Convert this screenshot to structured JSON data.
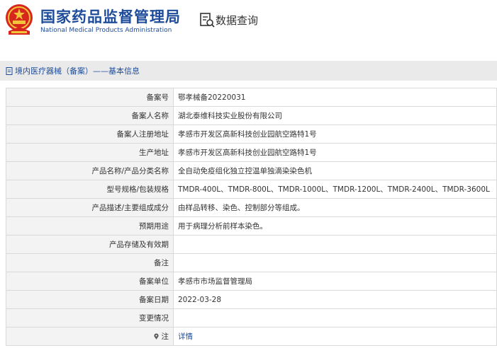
{
  "header": {
    "title_cn": "国家药品监督管理局",
    "title_en": "National Medical Products Administration",
    "query_label": "数据查询",
    "emblem_icon": "national-emblem-icon",
    "query_icon": "data-query-icon",
    "brand_color": "#1e4c9a"
  },
  "breadcrumb": {
    "text": "境内医疗器械（备案）——基本信息"
  },
  "record": {
    "rows": [
      {
        "label": "备案号",
        "value": "鄂孝械备20220031"
      },
      {
        "label": "备案人名称",
        "value": "湖北泰维科技实业股份有限公司"
      },
      {
        "label": "备案人注册地址",
        "value": "孝感市开发区高新科技创业园航空路特1号"
      },
      {
        "label": "生产地址",
        "value": "孝感市开发区高新科技创业园航空路特1号"
      },
      {
        "label": "产品名称/产品分类名称",
        "value": "全自动免疫组化独立控温单独滴染染色机"
      },
      {
        "label": "型号规格/包装规格",
        "value": "TMDR-400L、TMDR-800L、TMDR-1000L、TMDR-1200L、TMDR-2400L、TMDR-3600L"
      },
      {
        "label": "产品描述/主要组成成分",
        "value": "由样品转移、染色、控制部分等组成。"
      },
      {
        "label": "预期用途",
        "value": "用于病理分析前样本染色。"
      },
      {
        "label": "产品存储及有效期",
        "value": ""
      },
      {
        "label": "备注",
        "value": ""
      },
      {
        "label": "备案单位",
        "value": "孝感市市场监督管理局"
      },
      {
        "label": "备案日期",
        "value": "2022-03-28"
      },
      {
        "label": "变更情况",
        "value": ""
      }
    ],
    "note": {
      "label": "注",
      "icon": "location-pin-icon",
      "link_text": "详情"
    }
  }
}
